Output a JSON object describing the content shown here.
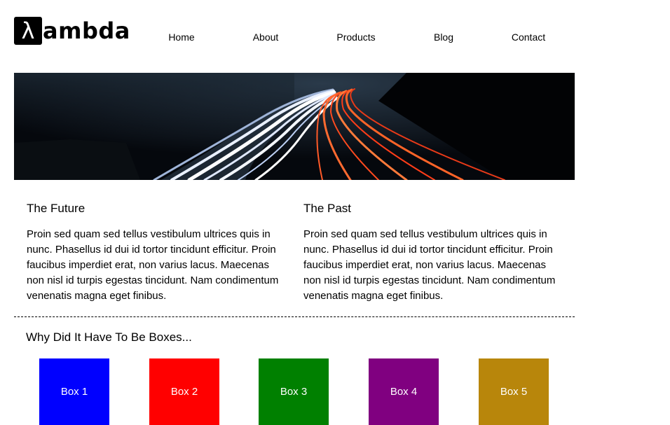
{
  "header": {
    "logo_symbol": "λ",
    "logo_text": "ambda",
    "nav": [
      "Home",
      "About",
      "Products",
      "Blog",
      "Contact"
    ]
  },
  "hero": {
    "image_icon": "highway-light-trails-photo"
  },
  "sections": [
    {
      "title": "The Future",
      "body": "Proin sed quam sed tellus vestibulum ultrices quis in nunc. Phasellus id dui id tortor tincidunt efficitur. Proin faucibus imperdiet erat, non varius lacus. Maecenas non nisl id turpis egestas tincidunt. Nam condimentum venenatis magna eget finibus."
    },
    {
      "title": "The Past",
      "body": "Proin sed quam sed tellus vestibulum ultrices quis in nunc. Phasellus id dui id tortor tincidunt efficitur. Proin faucibus imperdiet erat, non varius lacus. Maecenas non nisl id turpis egestas tincidunt. Nam condimentum venenatis magna eget finibus."
    }
  ],
  "boxes_section": {
    "title": "Why Did It Have To Be Boxes...",
    "boxes": [
      {
        "label": "Box 1",
        "color": "#0000ff"
      },
      {
        "label": "Box 2",
        "color": "#ff0000"
      },
      {
        "label": "Box 3",
        "color": "#008000"
      },
      {
        "label": "Box 4",
        "color": "#800080"
      },
      {
        "label": "Box 5",
        "color": "#b8860b"
      }
    ]
  }
}
